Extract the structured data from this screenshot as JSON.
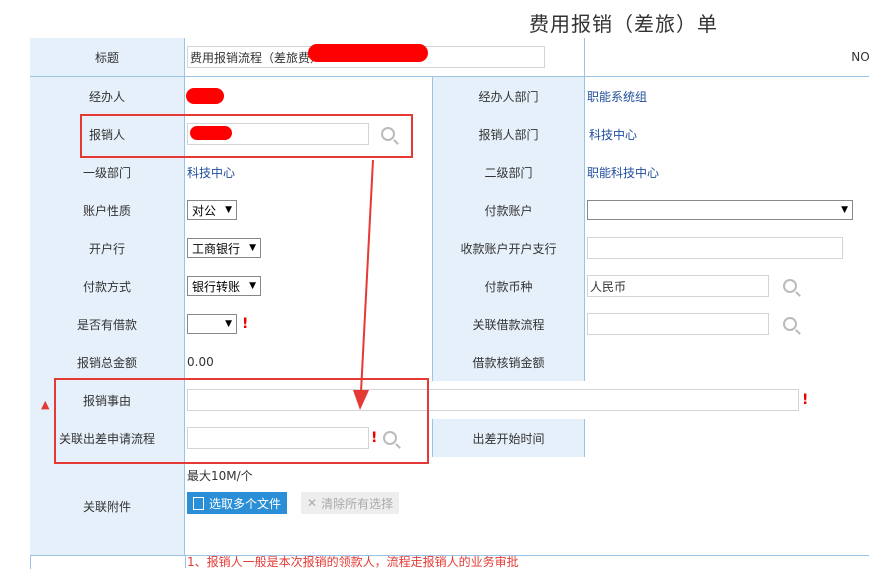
{
  "page_title": "费用报销（差旅）单",
  "no_label": "NO.",
  "rows": {
    "title": {
      "label": "标题",
      "value": "费用报销流程（差旅费）"
    },
    "handler": {
      "label": "经办人",
      "dept_label": "经办人部门",
      "dept_value": "职能系统组"
    },
    "claimant": {
      "label": "报销人",
      "dept_label": "报销人部门",
      "dept_value": "科技中心"
    },
    "level": {
      "label": "一级部门",
      "value": "科技中心",
      "label2": "二级部门",
      "value2": "职能科技中心"
    },
    "account": {
      "label": "账户性质",
      "value": "对公",
      "label2": "付款账户",
      "value2": ""
    },
    "bank": {
      "label": "开户行",
      "value": "工商银行",
      "label2": "收款账户开户支行",
      "value2": ""
    },
    "payment": {
      "label": "付款方式",
      "value": "银行转账",
      "label2": "付款币种",
      "value2": "人民币"
    },
    "loan": {
      "label": "是否有借款",
      "value": "",
      "label2": "关联借款流程",
      "value2": ""
    },
    "total": {
      "label": "报销总金额",
      "value": "0.00",
      "label2": "借款核销金额",
      "value2": ""
    },
    "reason": {
      "label": "报销事由",
      "value": ""
    },
    "trip": {
      "label": "关联出差申请流程",
      "value": "",
      "label2": "出差开始时间",
      "value2": ""
    },
    "attachment": {
      "label": "关联附件",
      "hint": "最大10M/个",
      "select_label": "选取多个文件",
      "clear_label": "清除所有选择"
    }
  },
  "footer_note": "1、报销人一般是本次报销的领款人，流程走报销人的业务审批"
}
